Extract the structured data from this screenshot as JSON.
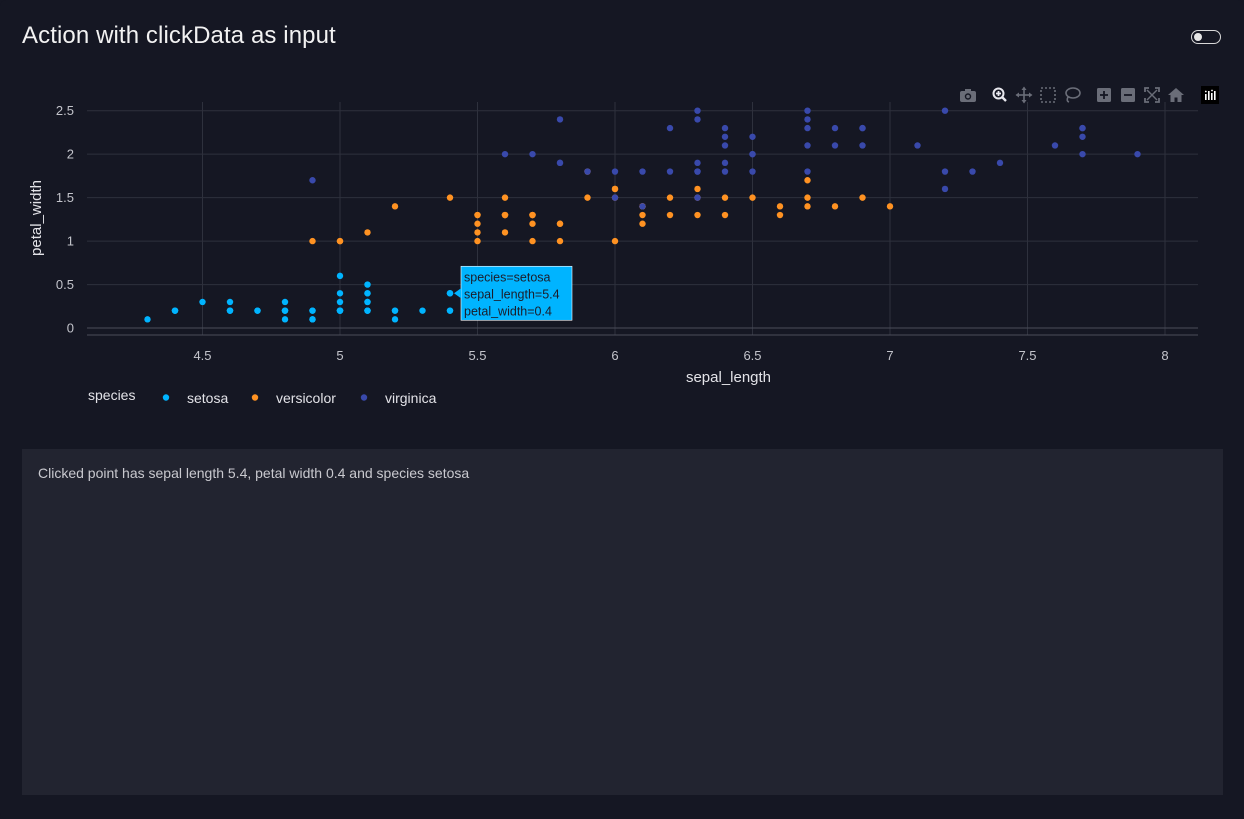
{
  "page": {
    "title": "Action with clickData as input"
  },
  "modebar": {
    "icons": [
      "camera-icon",
      "zoom-icon",
      "pan-icon",
      "box-select-icon",
      "lasso-icon",
      "zoom-in-icon",
      "zoom-out-icon",
      "autoscale-icon",
      "reset-axes-icon",
      "plotly-logo-icon"
    ]
  },
  "output": {
    "text": "Clicked point has sepal length 5.4, petal width 0.4 and species setosa"
  },
  "tooltip": {
    "line1": "species=setosa",
    "line2": "sepal_length=5.4",
    "line3": "petal_width=0.4",
    "x": 5.4,
    "y": 0.4,
    "color": "#00b4ff"
  },
  "chart_data": {
    "type": "scatter",
    "xlabel": "sepal_length",
    "ylabel": "petal_width",
    "xlim": [
      4.08,
      8.12
    ],
    "ylim": [
      -0.08,
      2.6
    ],
    "xticks": [
      4.5,
      5,
      5.5,
      6,
      6.5,
      7,
      7.5,
      8
    ],
    "xtick_labels": [
      "4.5",
      "5",
      "5.5",
      "6",
      "6.5",
      "7",
      "7.5",
      "8"
    ],
    "yticks": [
      0,
      0.5,
      1,
      1.5,
      2,
      2.5
    ],
    "ytick_labels": [
      "0",
      "0.5",
      "1",
      "1.5",
      "2",
      "2.5"
    ],
    "grid": true,
    "legend_title": "species",
    "legend_position": "bottom-left",
    "series": [
      {
        "name": "setosa",
        "color": "#00b4ff",
        "x": [
          5.1,
          4.9,
          4.7,
          4.6,
          5.0,
          5.4,
          4.6,
          5.0,
          4.4,
          4.9,
          5.4,
          4.8,
          4.8,
          4.3,
          5.8,
          5.7,
          5.4,
          5.1,
          5.7,
          5.1,
          5.4,
          5.1,
          4.6,
          5.1,
          4.8,
          5.0,
          5.0,
          5.2,
          5.2,
          4.7,
          4.8,
          5.4,
          5.2,
          5.5,
          4.9,
          5.0,
          5.5,
          4.9,
          4.4,
          5.1,
          5.0,
          4.5,
          4.4,
          5.0,
          5.1,
          4.8,
          5.1,
          4.6,
          5.3,
          5.0
        ],
        "y": [
          0.2,
          0.2,
          0.2,
          0.2,
          0.2,
          0.4,
          0.3,
          0.2,
          0.2,
          0.1,
          0.2,
          0.2,
          0.1,
          0.1,
          0.2,
          0.4,
          0.4,
          0.3,
          0.3,
          0.3,
          0.2,
          0.4,
          0.2,
          0.5,
          0.2,
          0.2,
          0.4,
          0.2,
          0.2,
          0.2,
          0.2,
          0.4,
          0.1,
          0.2,
          0.2,
          0.2,
          0.2,
          0.1,
          0.2,
          0.2,
          0.3,
          0.3,
          0.2,
          0.6,
          0.4,
          0.3,
          0.2,
          0.2,
          0.2,
          0.2
        ]
      },
      {
        "name": "versicolor",
        "color": "#ff9222",
        "x": [
          7.0,
          6.4,
          6.9,
          5.5,
          6.5,
          5.7,
          6.3,
          4.9,
          6.6,
          5.2,
          5.0,
          5.9,
          6.0,
          6.1,
          5.6,
          6.7,
          5.6,
          5.8,
          6.2,
          5.6,
          5.9,
          6.1,
          6.3,
          6.1,
          6.4,
          6.6,
          6.8,
          6.7,
          6.0,
          5.7,
          5.5,
          5.5,
          5.8,
          6.0,
          5.4,
          6.0,
          6.7,
          6.3,
          5.6,
          5.5,
          5.5,
          6.1,
          5.8,
          5.0,
          5.6,
          5.7,
          5.7,
          6.2,
          5.1,
          5.7
        ],
        "y": [
          1.4,
          1.5,
          1.5,
          1.3,
          1.5,
          1.3,
          1.6,
          1.0,
          1.3,
          1.4,
          1.0,
          1.5,
          1.0,
          1.4,
          1.3,
          1.4,
          1.5,
          1.0,
          1.5,
          1.1,
          1.8,
          1.3,
          1.5,
          1.2,
          1.3,
          1.4,
          1.4,
          1.7,
          1.5,
          1.0,
          1.1,
          1.0,
          1.2,
          1.6,
          1.5,
          1.6,
          1.5,
          1.3,
          1.3,
          1.3,
          1.2,
          1.4,
          1.2,
          1.0,
          1.3,
          1.2,
          1.3,
          1.3,
          1.1,
          1.3
        ]
      },
      {
        "name": "virginica",
        "color": "#3949ab",
        "x": [
          6.3,
          5.8,
          7.1,
          6.3,
          6.5,
          7.6,
          4.9,
          7.3,
          6.7,
          7.2,
          6.5,
          6.4,
          6.8,
          5.7,
          5.8,
          6.4,
          6.5,
          7.7,
          7.7,
          6.0,
          6.9,
          5.6,
          7.7,
          6.3,
          6.7,
          7.2,
          6.2,
          6.1,
          6.4,
          7.2,
          7.4,
          7.9,
          6.4,
          6.3,
          6.1,
          7.7,
          6.3,
          6.4,
          6.0,
          6.9,
          6.7,
          6.9,
          5.8,
          6.8,
          6.7,
          6.7,
          6.3,
          6.5,
          6.2,
          5.9
        ],
        "y": [
          2.5,
          1.9,
          2.1,
          1.8,
          2.2,
          2.1,
          1.7,
          1.8,
          1.8,
          2.5,
          2.0,
          1.9,
          2.1,
          2.0,
          2.4,
          2.3,
          1.8,
          2.2,
          2.3,
          1.5,
          2.3,
          2.0,
          2.0,
          1.8,
          2.1,
          1.8,
          1.8,
          1.8,
          2.1,
          1.6,
          1.9,
          2.0,
          2.2,
          1.5,
          1.4,
          2.3,
          2.4,
          1.8,
          1.8,
          2.1,
          2.4,
          2.3,
          1.9,
          2.3,
          2.5,
          2.3,
          1.9,
          2.0,
          2.3,
          1.8
        ]
      }
    ]
  }
}
